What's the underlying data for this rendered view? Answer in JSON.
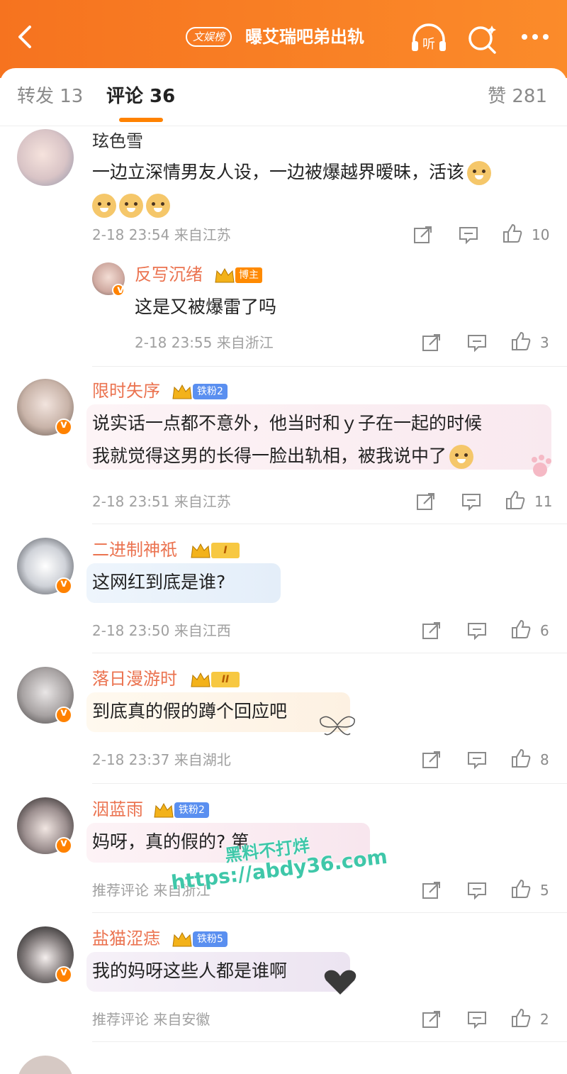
{
  "header": {
    "hot_badge": "文娱榜",
    "title": "曝艾瑞吧弟出轨",
    "listen_label": "听"
  },
  "tabs": {
    "repost": "转发 13",
    "comment": "评论 36",
    "like": "赞 281"
  },
  "comments": [
    {
      "name": "玹色雪",
      "text": "一边立深情男友人设，一边被爆越界暧昧，活该",
      "time": "2-18 23:54",
      "location": "来自江苏",
      "likes": "10"
    },
    {
      "name": "反写沉绪",
      "host_badge": "博主",
      "text": "这是又被爆雷了吗",
      "time": "2-18 23:55",
      "location": "来自浙江",
      "likes": "3"
    },
    {
      "name": "限时失序",
      "fan_badge": "铁粉2",
      "text_line1": "说实话一点都不意外，他当时和ｙ子在一起的时候",
      "text_line2": "我就觉得这男的长得一脸出轨相，被我说中了",
      "time": "2-18 23:51",
      "location": "来自江苏",
      "likes": "11"
    },
    {
      "name": "二进制神祇",
      "level_badge": "I",
      "text": "这网红到底是谁?",
      "time": "2-18 23:50",
      "location": "来自江西",
      "likes": "6"
    },
    {
      "name": "落日漫游时",
      "level_badge": "II",
      "text": "到底真的假的蹲个回应吧",
      "time": "2-18 23:37",
      "location": "来自湖北",
      "likes": "8"
    },
    {
      "name": "洇蓝雨",
      "fan_badge": "铁粉2",
      "text": "妈呀，真的假的?  第",
      "time": "推荐评论",
      "location": "来自浙江",
      "likes": "5"
    },
    {
      "name": "盐猫涩痣",
      "fan_badge": "铁粉5",
      "text": "我的妈呀这些人都是谁啊",
      "time": "推荐评论",
      "location": "来自安徽",
      "likes": "2"
    }
  ],
  "watermark": {
    "line1": "黑料不打烊",
    "line2": "https://abdy36.com"
  },
  "colors": {
    "accent": "#ff8200",
    "header_start": "#f6731f",
    "header_end": "#fb8b2a",
    "username": "#eb7350",
    "meta": "#a0a0a0",
    "watermark": "#3fc7a9"
  }
}
